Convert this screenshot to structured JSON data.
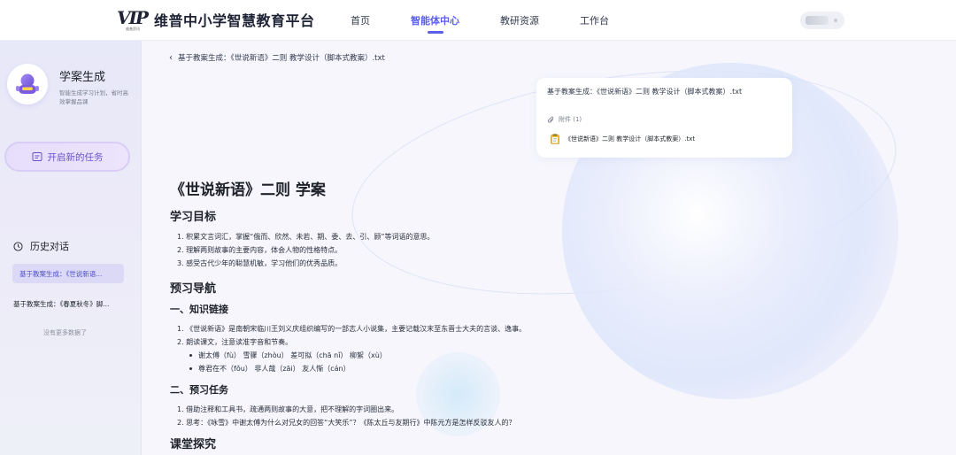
{
  "header": {
    "logo_mark": "VIP",
    "logo_sub": "维普资讯",
    "title": "维普中小学智慧教育平台",
    "nav": [
      {
        "label": "首页",
        "active": false
      },
      {
        "label": "智能体中心",
        "active": true
      },
      {
        "label": "教研资源",
        "active": false
      },
      {
        "label": "工作台",
        "active": false
      }
    ]
  },
  "sidebar": {
    "agent_name": "学案生成",
    "agent_desc": "智能生成学习计划，省时高效掌握品课",
    "new_task_label": "开启新的任务",
    "history_label": "历史对话",
    "history": [
      {
        "label": "基于教案生成：《世说新语...",
        "active": true
      },
      {
        "label": "基于教案生成：《春夏秋冬》脚...",
        "active": false
      }
    ],
    "no_more": "没有更多数据了"
  },
  "main": {
    "breadcrumb": "基于教案生成：《世说新语》二则 教学设计（脚本式教案）.txt",
    "attachment": {
      "title": "基于教案生成：《世说新语》二则 教学设计（脚本式教案）.txt",
      "label": "附件 (1)",
      "file": "《世说新语》二则 教学设计（脚本式教案）.txt"
    },
    "doc": {
      "title": "《世说新语》二则 学案",
      "goals_heading": "学习目标",
      "goals": [
        "1. 积累文言词汇，掌握“俄而、欣然、未若、期、委、去、引、顾”等词语的意思。",
        "2. 理解两则故事的主要内容，体会人物的性格特点。",
        "3. 感受古代少年的聪慧机敏，学习他们的优秀品质。"
      ],
      "preview_heading": "预习导航",
      "knowledge_heading": "一、知识链接",
      "knowledge": [
        "1. 《世说新语》是南朝宋临川王刘义庆组织编写的一部志人小说集，主要记载汉末至东晋士大夫的言谈、逸事。",
        "2. 朗读课文，注意读准字音和节奏。"
      ],
      "pronunciation": [
        "谢太傅（fù）  雪骤（zhòu）  差可拟（chā nǐ）  柳絮（xù）",
        "尊君在不（fǒu）  非人哉（zāi）  友人惭（cán）"
      ],
      "tasks_heading": "二、预习任务",
      "tasks": [
        "1. 借助注释和工具书，疏通两则故事的大意，把不理解的字词圈出来。",
        "2. 思考：《咏雪》中谢太傅为什么对兄女的回答“大笑乐”？《陈太丘与友期行》中陈元方是怎样反驳友人的？"
      ],
      "explore_heading": "课堂探究"
    }
  },
  "colors": {
    "accent": "#5b5ee8",
    "sidebar_active_bg": "#dcd9f6",
    "button_text": "#6a52c9"
  }
}
